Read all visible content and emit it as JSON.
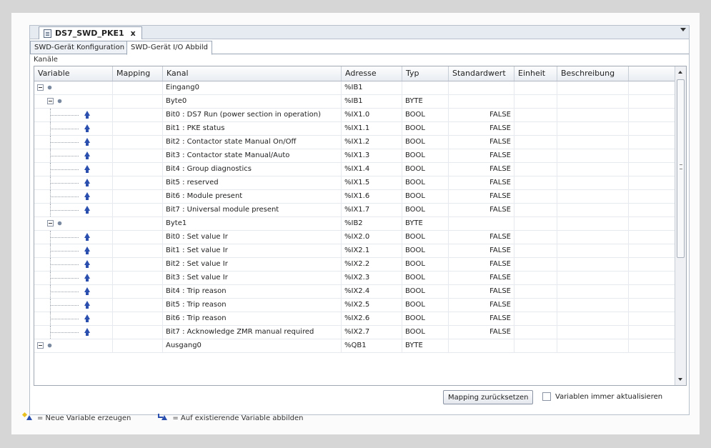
{
  "editor": {
    "doc_tab_title": "DS7_SWD_PKE1",
    "close_glyph": "x"
  },
  "subtabs": [
    {
      "label": "SWD-Gerät Konfiguration",
      "active": false
    },
    {
      "label": "SWD-Gerät I/O Abbild",
      "active": true
    }
  ],
  "section_label": "Kanäle",
  "grid": {
    "columns": [
      "Variable",
      "Mapping",
      "Kanal",
      "Adresse",
      "Typ",
      "Standardwert",
      "Einheit",
      "Beschreibung"
    ],
    "rows": [
      {
        "level": 0,
        "kind": "group",
        "kanal": "Eingang0",
        "adresse": "%IB1",
        "typ": "",
        "standard": ""
      },
      {
        "level": 1,
        "kind": "group",
        "kanal": "Byte0",
        "adresse": "%IB1",
        "typ": "BYTE",
        "standard": ""
      },
      {
        "level": 2,
        "kind": "leaf",
        "kanal": "Bit0 : DS7 Run (power section in operation)",
        "adresse": "%IX1.0",
        "typ": "BOOL",
        "standard": "FALSE"
      },
      {
        "level": 2,
        "kind": "leaf",
        "kanal": "Bit1 : PKE status",
        "adresse": "%IX1.1",
        "typ": "BOOL",
        "standard": "FALSE"
      },
      {
        "level": 2,
        "kind": "leaf",
        "kanal": "Bit2 : Contactor state Manual On/Off",
        "adresse": "%IX1.2",
        "typ": "BOOL",
        "standard": "FALSE"
      },
      {
        "level": 2,
        "kind": "leaf",
        "kanal": "Bit3 : Contactor state Manual/Auto",
        "adresse": "%IX1.3",
        "typ": "BOOL",
        "standard": "FALSE"
      },
      {
        "level": 2,
        "kind": "leaf",
        "kanal": "Bit4 : Group diagnostics",
        "adresse": "%IX1.4",
        "typ": "BOOL",
        "standard": "FALSE"
      },
      {
        "level": 2,
        "kind": "leaf",
        "kanal": "Bit5 : reserved",
        "adresse": "%IX1.5",
        "typ": "BOOL",
        "standard": "FALSE"
      },
      {
        "level": 2,
        "kind": "leaf",
        "kanal": "Bit6 : Module present",
        "adresse": "%IX1.6",
        "typ": "BOOL",
        "standard": "FALSE"
      },
      {
        "level": 2,
        "kind": "leaf",
        "kanal": "Bit7 : Universal module present",
        "adresse": "%IX1.7",
        "typ": "BOOL",
        "standard": "FALSE"
      },
      {
        "level": 1,
        "kind": "group",
        "kanal": "Byte1",
        "adresse": "%IB2",
        "typ": "BYTE",
        "standard": ""
      },
      {
        "level": 2,
        "kind": "leaf",
        "kanal": "Bit0 : Set value Ir",
        "adresse": "%IX2.0",
        "typ": "BOOL",
        "standard": "FALSE"
      },
      {
        "level": 2,
        "kind": "leaf",
        "kanal": "Bit1 : Set value Ir",
        "adresse": "%IX2.1",
        "typ": "BOOL",
        "standard": "FALSE"
      },
      {
        "level": 2,
        "kind": "leaf",
        "kanal": "Bit2 : Set value Ir",
        "adresse": "%IX2.2",
        "typ": "BOOL",
        "standard": "FALSE"
      },
      {
        "level": 2,
        "kind": "leaf",
        "kanal": "Bit3 : Set value Ir",
        "adresse": "%IX2.3",
        "typ": "BOOL",
        "standard": "FALSE"
      },
      {
        "level": 2,
        "kind": "leaf",
        "kanal": "Bit4 : Trip reason",
        "adresse": "%IX2.4",
        "typ": "BOOL",
        "standard": "FALSE"
      },
      {
        "level": 2,
        "kind": "leaf",
        "kanal": "Bit5 : Trip reason",
        "adresse": "%IX2.5",
        "typ": "BOOL",
        "standard": "FALSE"
      },
      {
        "level": 2,
        "kind": "leaf",
        "kanal": "Bit6 : Trip reason",
        "adresse": "%IX2.6",
        "typ": "BOOL",
        "standard": "FALSE"
      },
      {
        "level": 2,
        "kind": "leaf",
        "kanal": "Bit7 : Acknowledge ZMR manual required",
        "adresse": "%IX2.7",
        "typ": "BOOL",
        "standard": "FALSE"
      },
      {
        "level": 0,
        "kind": "group",
        "kanal": "Ausgang0",
        "adresse": "%QB1",
        "typ": "BYTE",
        "standard": ""
      }
    ]
  },
  "footer": {
    "reset_button": "Mapping zurücksetzen",
    "always_update_label": "Variablen immer aktualisieren",
    "always_update_checked": false
  },
  "legend": {
    "new_variable": "= Neue Variable erzeugen",
    "map_existing": "= Auf existierende Variable abbilden"
  },
  "colors": {
    "input_icon": "#2a4fae",
    "new_icon": "#e8c020"
  }
}
